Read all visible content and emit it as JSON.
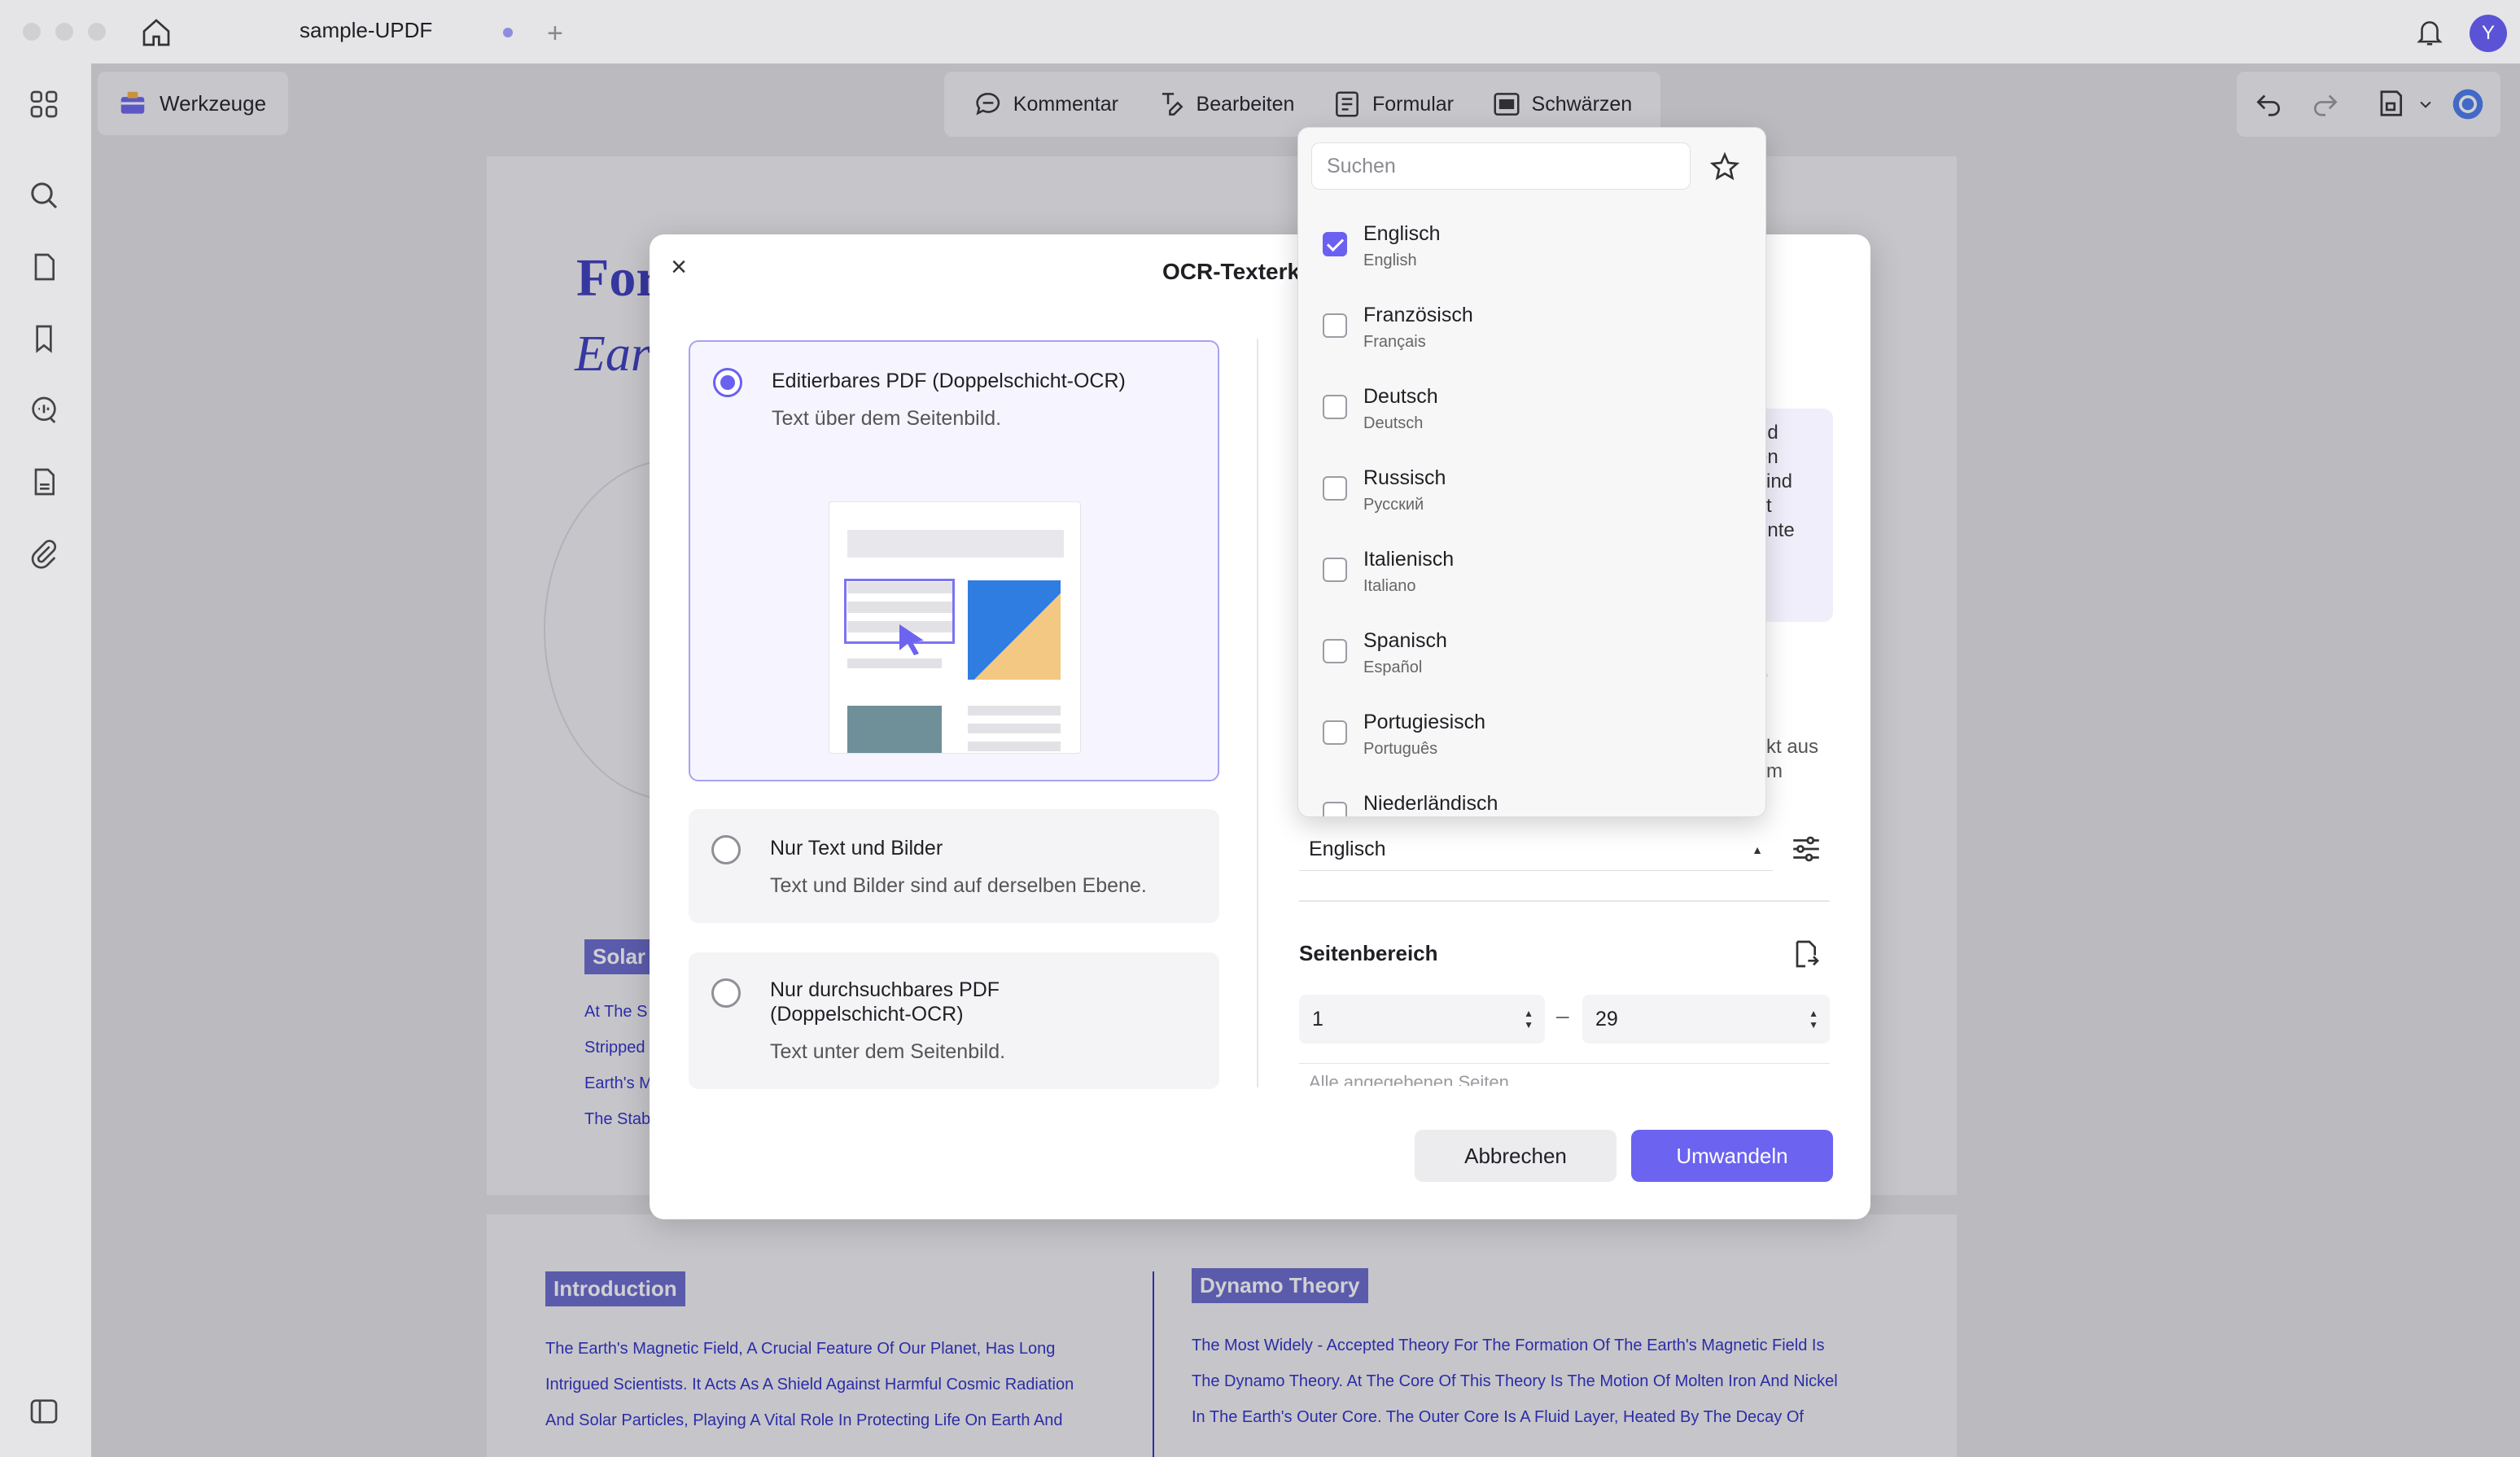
{
  "window": {
    "tab_title": "sample-UPDF",
    "avatar_initial": "Y"
  },
  "toolbar": {
    "tools_label": "Werkzeuge",
    "items": [
      {
        "label": "Kommentar",
        "icon": "comment-icon"
      },
      {
        "label": "Bearbeiten",
        "icon": "edit-icon"
      },
      {
        "label": "Formular",
        "icon": "form-icon"
      },
      {
        "label": "Schwärzen",
        "icon": "redact-icon"
      }
    ]
  },
  "document": {
    "title_fragment": "For",
    "subtitle_fragment": "Ear",
    "solar_tag": "Solar",
    "side_lines": [
      "At The S",
      "Stripped",
      "Earth's M",
      "The Stab"
    ],
    "intro": {
      "tag": "Introduction",
      "lines": [
        "The Earth's Magnetic Field, A Crucial Feature Of Our Planet, Has Long",
        "Intrigued Scientists. It Acts As A Shield Against Harmful Cosmic Radiation",
        "And Solar Particles, Playing A Vital Role In Protecting Life On Earth And"
      ]
    },
    "dynamo": {
      "tag": "Dynamo Theory",
      "lines": [
        "The Most Widely - Accepted Theory For The Formation Of The Earth's Magnetic Field Is",
        "The Dynamo Theory. At The Core Of This Theory Is The Motion Of Molten Iron And Nickel",
        "In The Earth's Outer Core. The Outer Core Is A Fluid Layer, Heated By The Decay Of"
      ]
    }
  },
  "ocr_dialog": {
    "title": "OCR-Texterke",
    "options": [
      {
        "title": "Editierbares PDF (Doppelschicht-OCR)",
        "subtitle": "Text über dem Seitenbild.",
        "selected": true
      },
      {
        "title": "Nur Text und Bilder",
        "subtitle": "Text und Bilder sind auf derselben Ebene.",
        "selected": false
      },
      {
        "title_line1": "Nur durchsuchbares PDF",
        "title_line2": "(Doppelschicht-OCR)",
        "subtitle": "Text unter dem Seitenbild.",
        "selected": false
      }
    ],
    "info_fragments": [
      "nd",
      "en",
      "sind",
      "xt",
      "nnte"
    ],
    "hint_fragments": [
      "kt aus",
      "m"
    ],
    "language_value": "Englisch",
    "page_range": {
      "title": "Seitenbereich",
      "from": "1",
      "to": "29",
      "filter": "Alle angegebenen Seiten"
    },
    "cancel_label": "Abbrechen",
    "convert_label": "Umwandeln"
  },
  "language_popover": {
    "search_placeholder": "Suchen",
    "languages": [
      {
        "name": "Englisch",
        "native": "English",
        "checked": true
      },
      {
        "name": "Französisch",
        "native": "Français",
        "checked": false
      },
      {
        "name": "Deutsch",
        "native": "Deutsch",
        "checked": false
      },
      {
        "name": "Russisch",
        "native": "Русский",
        "checked": false
      },
      {
        "name": "Italienisch",
        "native": "Italiano",
        "checked": false
      },
      {
        "name": "Spanisch",
        "native": "Español",
        "checked": false
      },
      {
        "name": "Portugiesisch",
        "native": "Português",
        "checked": false
      },
      {
        "name": "Niederländisch",
        "native": "",
        "checked": false
      }
    ]
  },
  "colors": {
    "accent": "#6c63f0",
    "document_blue": "#2d2dc9"
  }
}
